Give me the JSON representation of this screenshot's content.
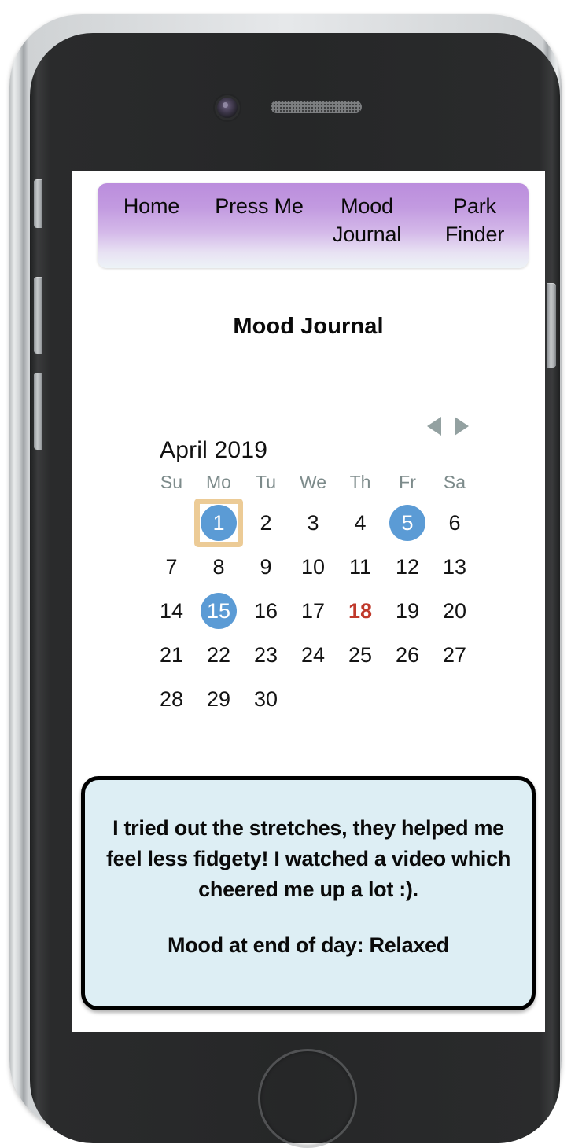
{
  "nav": {
    "items": [
      {
        "label": "Home"
      },
      {
        "label": "Press Me"
      },
      {
        "label": "Mood Journal"
      },
      {
        "label": "Park Finder"
      }
    ]
  },
  "page": {
    "title": "Mood Journal"
  },
  "calendar": {
    "month_label": "April 2019",
    "prev_icon": "triangle-left-icon",
    "next_icon": "triangle-right-icon",
    "weekdays": [
      "Su",
      "Mo",
      "Tu",
      "We",
      "Th",
      "Fr",
      "Sa"
    ],
    "lead_blanks": 1,
    "days": [
      {
        "n": "1",
        "marked": true,
        "selected": true,
        "today": false
      },
      {
        "n": "2",
        "marked": false,
        "selected": false,
        "today": false
      },
      {
        "n": "3",
        "marked": false,
        "selected": false,
        "today": false
      },
      {
        "n": "4",
        "marked": false,
        "selected": false,
        "today": false
      },
      {
        "n": "5",
        "marked": true,
        "selected": false,
        "today": false
      },
      {
        "n": "6",
        "marked": false,
        "selected": false,
        "today": false
      },
      {
        "n": "7",
        "marked": false,
        "selected": false,
        "today": false
      },
      {
        "n": "8",
        "marked": false,
        "selected": false,
        "today": false
      },
      {
        "n": "9",
        "marked": false,
        "selected": false,
        "today": false
      },
      {
        "n": "10",
        "marked": false,
        "selected": false,
        "today": false
      },
      {
        "n": "11",
        "marked": false,
        "selected": false,
        "today": false
      },
      {
        "n": "12",
        "marked": false,
        "selected": false,
        "today": false
      },
      {
        "n": "13",
        "marked": false,
        "selected": false,
        "today": false
      },
      {
        "n": "14",
        "marked": false,
        "selected": false,
        "today": false
      },
      {
        "n": "15",
        "marked": true,
        "selected": false,
        "today": false
      },
      {
        "n": "16",
        "marked": false,
        "selected": false,
        "today": false
      },
      {
        "n": "17",
        "marked": false,
        "selected": false,
        "today": false
      },
      {
        "n": "18",
        "marked": false,
        "selected": false,
        "today": true
      },
      {
        "n": "19",
        "marked": false,
        "selected": false,
        "today": false
      },
      {
        "n": "20",
        "marked": false,
        "selected": false,
        "today": false
      },
      {
        "n": "21",
        "marked": false,
        "selected": false,
        "today": false
      },
      {
        "n": "22",
        "marked": false,
        "selected": false,
        "today": false
      },
      {
        "n": "23",
        "marked": false,
        "selected": false,
        "today": false
      },
      {
        "n": "24",
        "marked": false,
        "selected": false,
        "today": false
      },
      {
        "n": "25",
        "marked": false,
        "selected": false,
        "today": false
      },
      {
        "n": "26",
        "marked": false,
        "selected": false,
        "today": false
      },
      {
        "n": "27",
        "marked": false,
        "selected": false,
        "today": false
      },
      {
        "n": "28",
        "marked": false,
        "selected": false,
        "today": false
      },
      {
        "n": "29",
        "marked": false,
        "selected": false,
        "today": false
      },
      {
        "n": "30",
        "marked": false,
        "selected": false,
        "today": false
      }
    ],
    "colors": {
      "marked_day": "#5b9bd5",
      "selected_outline": "#eccb96",
      "today_text": "#c0392b",
      "weekday_text": "#7d8b8b",
      "arrow": "#93a1a1"
    }
  },
  "journal": {
    "entry_text": "I tried out the stretches, they helped me feel less fidgety! I watched a video which cheered me up a lot :).",
    "mood_line": "Mood at end of day: Relaxed",
    "background_color": "#ddeef4",
    "border_color": "#000000"
  },
  "device": {
    "camera_icon": "camera-lens-icon",
    "speaker_icon": "speaker-grille-icon",
    "home_button_icon": "home-button-icon"
  },
  "theme": {
    "nav_gradient_top": "#bb8ddd",
    "nav_gradient_bottom": "#edf3f7",
    "screen_background": "#ffffff"
  }
}
